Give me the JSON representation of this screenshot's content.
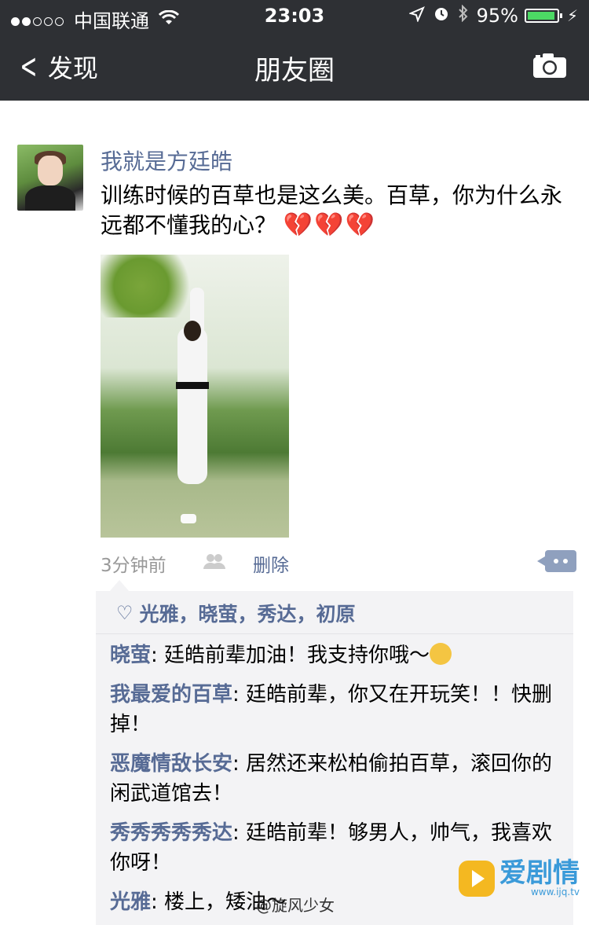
{
  "status": {
    "carrier": "中国联通",
    "time": "23:03",
    "battery": "95%"
  },
  "nav": {
    "back_label": "发现",
    "title": "朋友圈"
  },
  "post": {
    "author": "我就是方廷皓",
    "text": "训练时候的百草也是这么美。百草，你为什么永远都不懂我的心？",
    "emoji": "💔💔💔",
    "time_ago": "3分钟前",
    "delete_label": "删除"
  },
  "likes": "光雅，晓萤，秀达，初原",
  "comments": [
    {
      "name": "晓萤",
      "text": "廷皓前辈加油！我支持你哦～"
    },
    {
      "name": "我最爱的百草",
      "text": "廷皓前辈，你又在开玩笑！！快删掉！"
    },
    {
      "name": "恶魔情敌长安",
      "text": "居然还来松柏偷拍百草，滚回你的闲武道馆去！"
    },
    {
      "name": "秀秀秀秀秀达",
      "text": "廷皓前辈！够男人，帅气，我喜欢你呀！"
    },
    {
      "name": "光雅",
      "text": "楼上，矮油～"
    }
  ],
  "watermark": "@旋风少女",
  "logo": {
    "brand": "爱剧情",
    "url": "www.ijq.tv"
  },
  "colors": {
    "navbar": "#2e3034",
    "link": "#576b95",
    "comment_bg": "#f3f3f5",
    "battery": "#4cd964"
  }
}
